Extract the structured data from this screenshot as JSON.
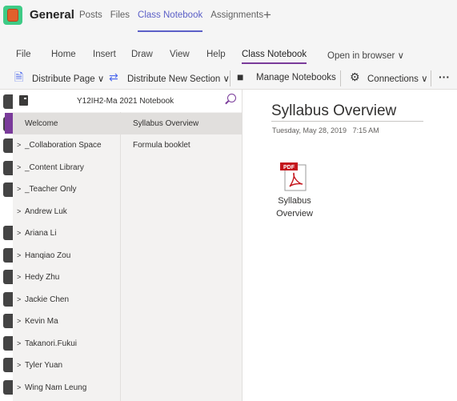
{
  "header": {
    "channel_title": "General",
    "tabs": [
      {
        "label": "Posts",
        "active": false
      },
      {
        "label": "Files",
        "active": false
      },
      {
        "label": "Class Notebook",
        "active": true
      },
      {
        "label": "Assignments",
        "active": false
      }
    ],
    "add_tab_icon": "plus-icon",
    "accent": "#5b5fc7"
  },
  "ribbon": {
    "menus": [
      {
        "label": "File"
      },
      {
        "label": "Home"
      },
      {
        "label": "Insert"
      },
      {
        "label": "Draw"
      },
      {
        "label": "View"
      },
      {
        "label": "Help"
      },
      {
        "label": "Class Notebook",
        "active": true
      },
      {
        "label": "Open in browser ∨"
      }
    ],
    "tools": {
      "distribute_page": "Distribute Page ∨",
      "distribute_new_section": "Distribute New Section ∨",
      "manage_notebooks": "Manage Notebooks",
      "connections": "Connections ∨",
      "more": "···"
    }
  },
  "notebook": {
    "name": "Y12IH2-Ma 2021 Notebook",
    "accent": "#7a3b9a",
    "sections": [
      {
        "label": "Welcome",
        "selected": true,
        "expandable": false
      },
      {
        "label": "_Collaboration Space",
        "expandable": true
      },
      {
        "label": "_Content Library",
        "expandable": true
      },
      {
        "label": "_Teacher Only",
        "expandable": true
      },
      {
        "label": "Andrew Luk",
        "expandable": true
      },
      {
        "label": "Ariana Li",
        "expandable": true
      },
      {
        "label": "Hanqiao Zou",
        "expandable": true
      },
      {
        "label": "Hedy Zhu",
        "expandable": true
      },
      {
        "label": "Jackie Chen",
        "expandable": true
      },
      {
        "label": "Kevin Ma",
        "expandable": true
      },
      {
        "label": "Takanori.Fukui",
        "expandable": true
      },
      {
        "label": "Tyler Yuan",
        "expandable": true
      },
      {
        "label": "Wing Nam Leung",
        "expandable": true
      }
    ],
    "pages": [
      {
        "label": "Syllabus Overview",
        "selected": true
      },
      {
        "label": "Formula booklet"
      }
    ]
  },
  "page": {
    "title": "Syllabus Overview",
    "date": "Tuesday, May 28, 2019",
    "time": "7:15 AM",
    "attachment": {
      "icon": "pdf-icon",
      "badge": "PDF",
      "name_line1": "Syllabus",
      "name_line2": "Overview"
    }
  }
}
